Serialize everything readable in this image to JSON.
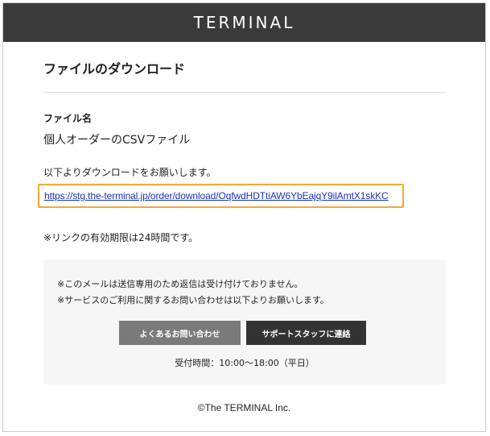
{
  "header": {
    "logo_text": "TERMINAL"
  },
  "main": {
    "title": "ファイルのダウンロード",
    "file_label": "ファイル名",
    "file_name": "個人オーダーのCSVファイル",
    "intro_text": "以下よりダウンロードをお願いします。",
    "download_link": "https://stg.the-terminal.jp/order/download/OqfwdHDTtiAW6YbEajqY9ilAmtX1skKC",
    "expiry_note": "※リンクの有効期限は24時間です。"
  },
  "notice": {
    "line1": "※このメールは送信専用のため返信は受け付けておりません。",
    "line2": "※サービスのご利用に関するお問い合わせは以下よりお願いします。",
    "faq_button": "よくあるお問い合わせ",
    "support_button": "サポートスタッフに連絡",
    "hours": "受付時間：10:00〜18:00（平日）"
  },
  "footer": {
    "copyright": "©The TERMINAL Inc."
  },
  "colors": {
    "header_bg": "#3a3a3a",
    "link": "#1a33b8",
    "highlight_border": "#f3a83a",
    "faq_button_bg": "#7a7a7a",
    "support_button_bg": "#333333",
    "notice_bg": "#f6f6f6"
  }
}
